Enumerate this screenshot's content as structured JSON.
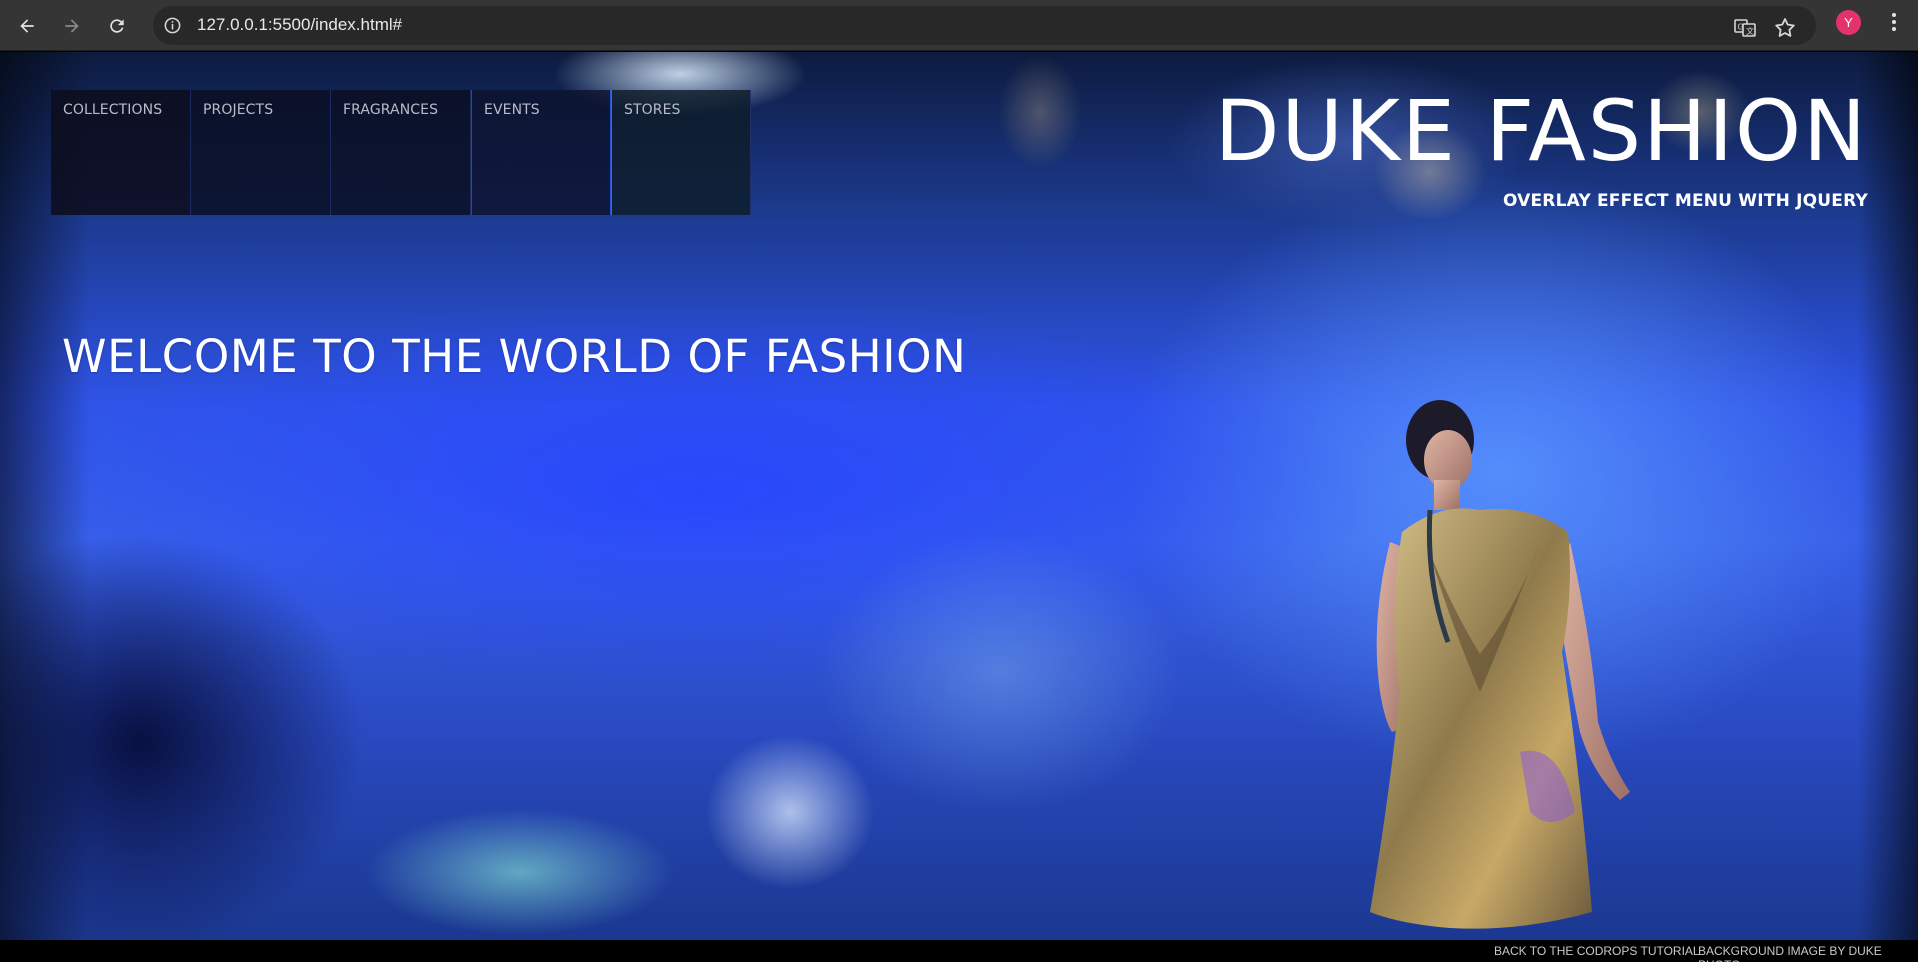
{
  "browser": {
    "url": "127.0.0.1:5500/index.html#",
    "avatar_letter": "Y",
    "icons": [
      "back-icon",
      "forward-icon",
      "reload-icon",
      "site-info-icon",
      "translate-icon",
      "bookmark-star-icon",
      "menu-dots-icon"
    ]
  },
  "menu": {
    "items": [
      {
        "label": "COLLECTIONS"
      },
      {
        "label": "PROJECTS"
      },
      {
        "label": "FRAGRANCES"
      },
      {
        "label": "EVENTS"
      },
      {
        "label": "STORES"
      }
    ]
  },
  "brand": {
    "title": "DUKE FASHION",
    "subtitle": "OVERLAY EFFECT MENU WITH JQUERY"
  },
  "welcome": "WELCOME TO THE WORLD OF FASHION",
  "footer": {
    "tutorial_link": "BACK TO THE CODROPS TUTORIAL",
    "credit_link": "BACKGROUND IMAGE BY DUKE PHOTO"
  },
  "colors": {
    "chrome_bg": "#353535",
    "omnibox_bg": "#282828",
    "avatar_bg": "#e2336b",
    "page_blue": "#2f54e8"
  }
}
